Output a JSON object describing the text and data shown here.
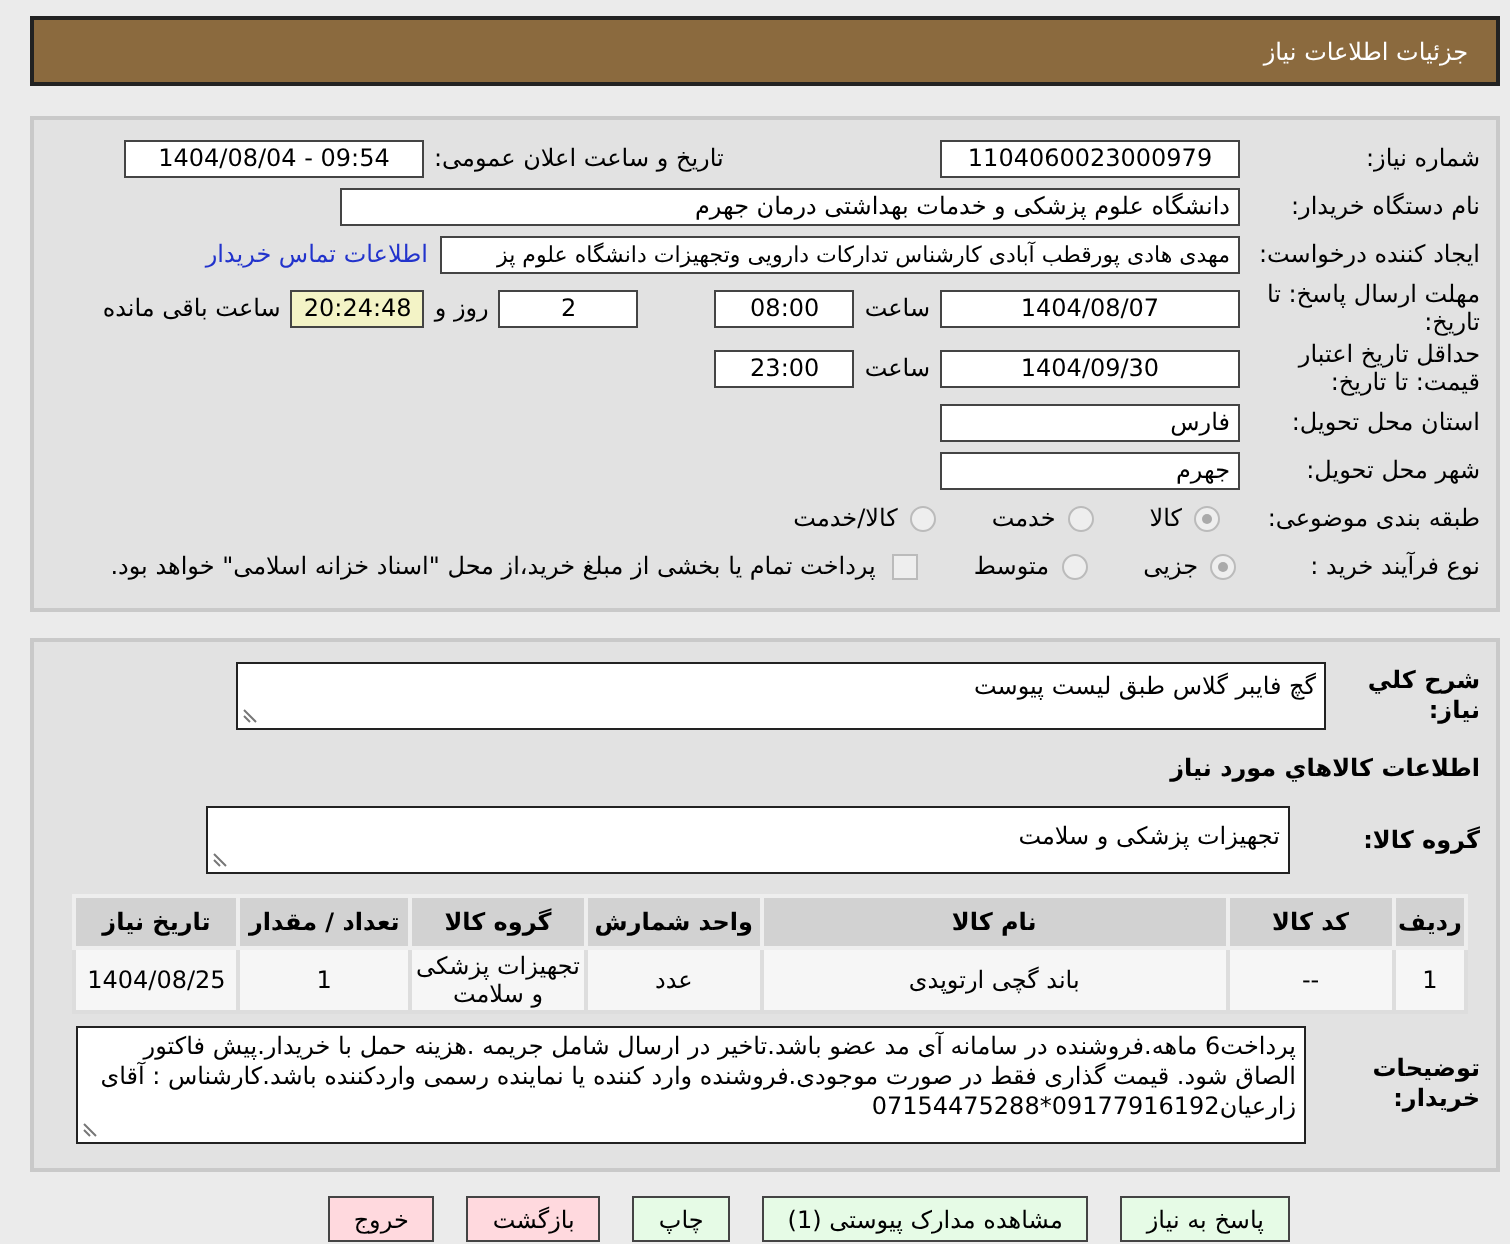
{
  "header": {
    "title": "جزئیات اطلاعات نیاز"
  },
  "info": {
    "need_number": {
      "label": "شماره نیاز:",
      "value": "1104060023000979"
    },
    "announce": {
      "label": "تاریخ و ساعت اعلان عمومی:",
      "value": "1404/08/04 - 09:54"
    },
    "buyer": {
      "label": "نام دستگاه خریدار:",
      "value": "دانشگاه علوم پزشکی و خدمات بهداشتی  درمان جهرم"
    },
    "creator": {
      "label": "ایجاد کننده درخواست:",
      "value": "مهدی هادی پورقطب آبادی کارشناس تدارکات دارویی وتجهیزات دانشگاه علوم پز",
      "link": "اطلاعات تماس خریدار"
    },
    "deadline": {
      "label": "مهلت ارسال پاسخ: تا تاریخ:",
      "date": "1404/08/07",
      "time_label": "ساعت",
      "time": "08:00",
      "days": "2",
      "days_label": "روز و",
      "remaining": "20:24:48",
      "remaining_label": "ساعت باقی مانده"
    },
    "validity": {
      "label": "حداقل تاریخ اعتبار قیمت: تا تاریخ:",
      "date": "1404/09/30",
      "time_label": "ساعت",
      "time": "23:00"
    },
    "province": {
      "label": "استان محل تحویل:",
      "value": "فارس"
    },
    "city": {
      "label": "شهر محل تحویل:",
      "value": "جهرم"
    },
    "category": {
      "label": "طبقه بندی موضوعی:",
      "options": [
        {
          "label": "کالا",
          "selected": true
        },
        {
          "label": "خدمت",
          "selected": false
        },
        {
          "label": "کالا/خدمت",
          "selected": false
        }
      ]
    },
    "process": {
      "label": "نوع فرآیند خرید :",
      "options": [
        {
          "label": "جزیی",
          "selected": true
        },
        {
          "label": "متوسط",
          "selected": false
        }
      ],
      "payment": {
        "label": "پرداخت تمام یا بخشی از مبلغ خرید،از محل \"اسناد خزانه اسلامی\" خواهد بود.",
        "checked": false
      }
    }
  },
  "goods": {
    "description": {
      "label": "شرح كلي نياز:",
      "value": "گچ فایبر گلاس طبق لیست پیوست"
    },
    "section_title": "اطلاعات كالاهاي مورد نياز",
    "group": {
      "label": "گروه کالا:",
      "value": "تجهیزات پزشکی و سلامت"
    },
    "table": {
      "columns": [
        "ردیف",
        "کد کالا",
        "نام کالا",
        "واحد شمارش",
        "گروه کالا",
        "تعداد / مقدار",
        "تاریخ نیاز"
      ],
      "rows": [
        [
          "1",
          "--",
          "باند گچی ارتوپدی",
          "عدد",
          "تجهیزات پزشکی و سلامت",
          "1",
          "1404/08/25"
        ]
      ]
    },
    "notes": {
      "label": "توضیحات خریدار:",
      "value": "پرداخت6 ماهه.فروشنده در سامانه آی مد عضو باشد.تاخیر در ارسال شامل جریمه .هزینه حمل با خریدار.پیش فاکتور الصاق شود. قیمت گذاری فقط در صورت موجودی.فروشنده وارد کننده یا نماینده رسمی واردکننده باشد.کارشناس : آقای زارعیان09177916192*07154475288"
    }
  },
  "buttons": [
    {
      "label": "پاسخ به نیاز",
      "kind": "normal"
    },
    {
      "label": "مشاهده مدارک پیوستی (1)",
      "kind": "normal"
    },
    {
      "label": "چاپ",
      "kind": "normal"
    },
    {
      "label": "بازگشت",
      "kind": "exit"
    },
    {
      "label": "خروج",
      "kind": "exit"
    }
  ]
}
